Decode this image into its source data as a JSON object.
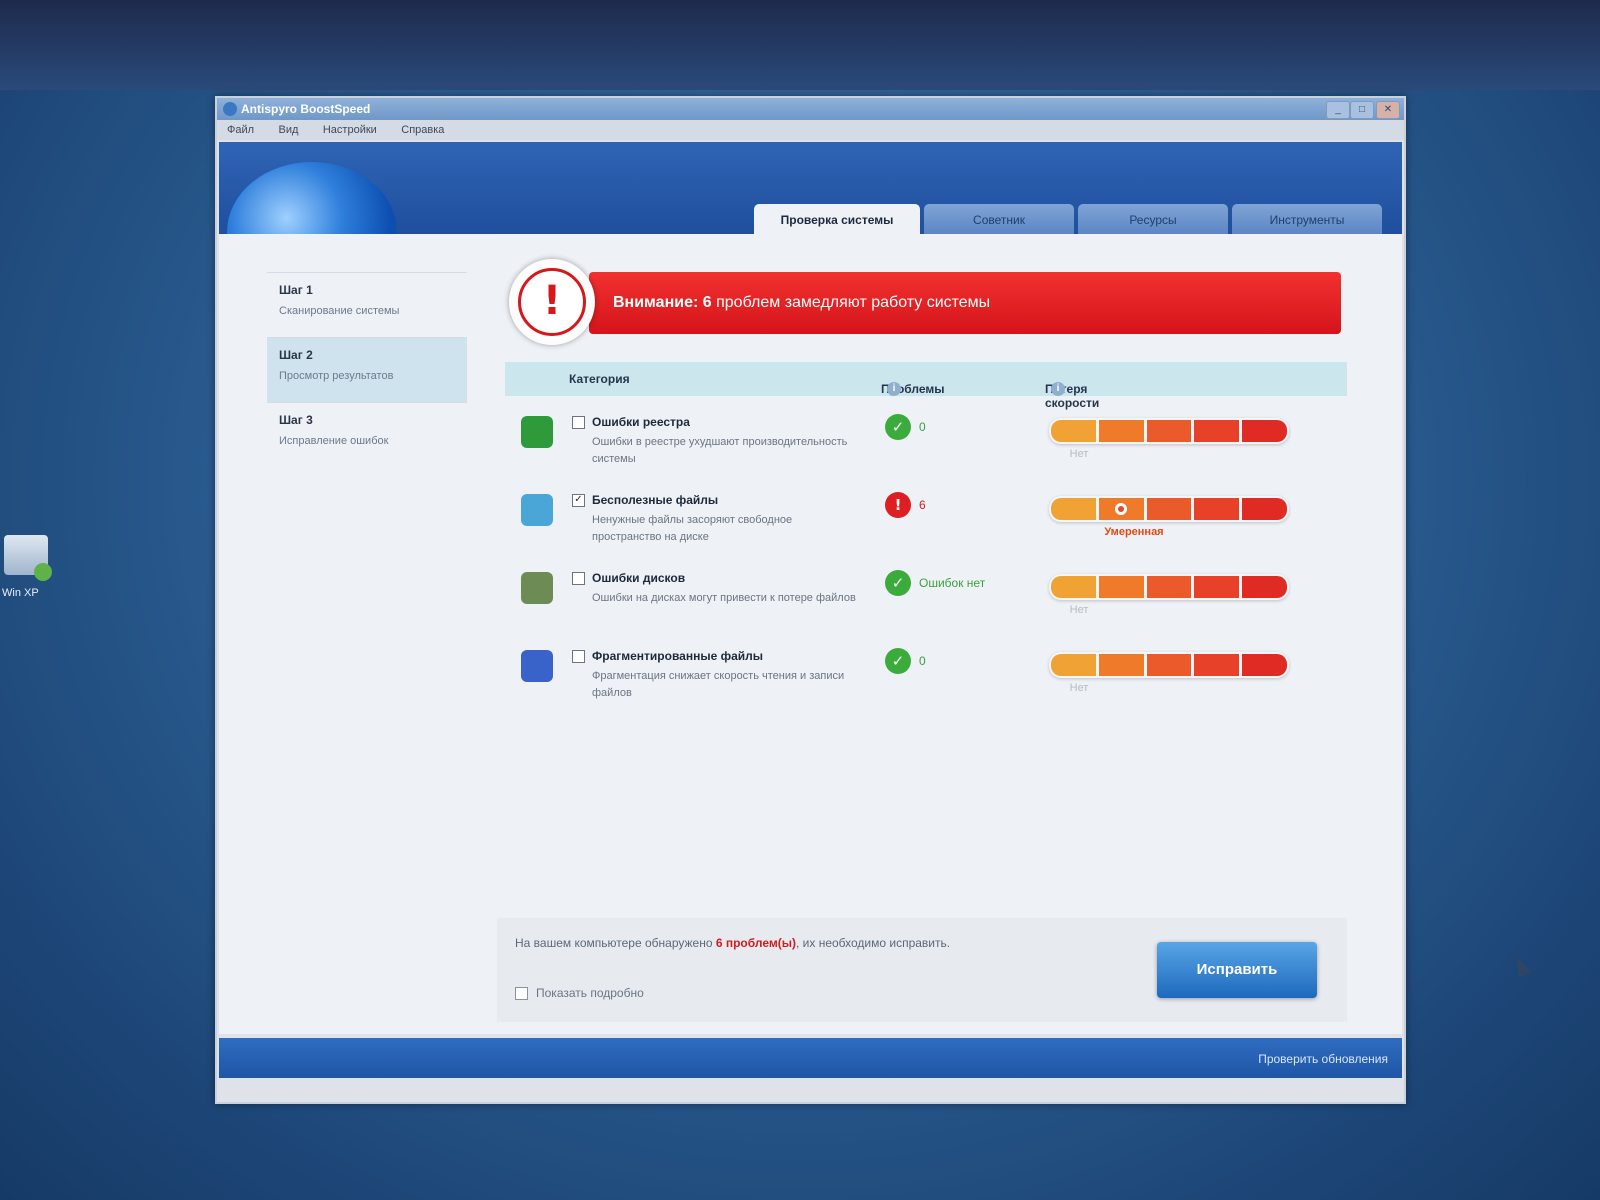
{
  "window": {
    "title": "Antispyro BoostSpeed",
    "menu": [
      "Файл",
      "Вид",
      "Настройки",
      "Справка"
    ]
  },
  "tabs": [
    {
      "label": "Проверка системы",
      "active": true
    },
    {
      "label": "Советник",
      "active": false
    },
    {
      "label": "Ресурсы",
      "active": false
    },
    {
      "label": "Инструменты",
      "active": false
    }
  ],
  "steps": [
    {
      "title": "Шаг 1",
      "desc": "Сканирование системы",
      "active": false
    },
    {
      "title": "Шаг 2",
      "desc": "Просмотр результатов",
      "active": true
    },
    {
      "title": "Шаг 3",
      "desc": "Исправление ошибок",
      "active": false
    }
  ],
  "alert": {
    "prefix": "Внимание: 6",
    "message": " проблем замедляют работу системы",
    "badge": "!"
  },
  "table": {
    "col_category": "Категория",
    "col_problems": "Проблемы",
    "col_speed": "Потеря скорости",
    "info_glyph": "i"
  },
  "rows": [
    {
      "title": "Ошибки реестра",
      "desc": "Ошибки в реестре ухудшают производительность системы",
      "checked": false,
      "status_glyph": "✓",
      "status_text": "0",
      "status": "ok",
      "speed_label": "Нет",
      "icon_color": "#2f9a3a"
    },
    {
      "title": "Бесполезные файлы",
      "desc": "Ненужные файлы засоряют свободное пространство на диске",
      "checked": true,
      "status_glyph": "!",
      "status_text": "6",
      "status": "bad",
      "speed_label": "Умеренная",
      "speed_level": 2,
      "icon_color": "#4ba6d8"
    },
    {
      "title": "Ошибки дисков",
      "desc": "Ошибки на дисках могут привести к потере файлов",
      "checked": false,
      "status_glyph": "✓",
      "status_text": "Ошибок нет",
      "status": "ok",
      "speed_label": "Нет",
      "icon_color": "#6d8b55"
    },
    {
      "title": "Фрагментированные файлы",
      "desc": "Фрагментация снижает скорость чтения и записи файлов",
      "checked": false,
      "status_glyph": "✓",
      "status_text": "0",
      "status": "ok",
      "speed_label": "Нет",
      "icon_color": "#3a63c9"
    }
  ],
  "footer": {
    "summary_prefix": "На вашем компьютере обнаружено ",
    "summary_count": "6 проблем(ы)",
    "summary_suffix": ", их необходимо исправить.",
    "show_details": "Показать подробно",
    "fix_button": "Исправить"
  },
  "statusbar": {
    "updates_link": "Проверить обновления"
  },
  "desktop": {
    "icon_label": "Win XP"
  },
  "colors": {
    "alert_red": "#d4141a",
    "accent_blue": "#1f4f9e",
    "ok_green": "#3bab3c"
  }
}
